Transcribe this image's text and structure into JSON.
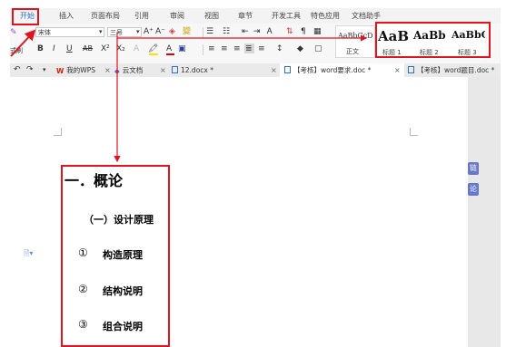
{
  "menu": {
    "items": [
      "开始",
      "插入",
      "页面布局",
      "引用",
      "审阅",
      "视图",
      "章节",
      "开发工具",
      "特色应用",
      "文档助手"
    ]
  },
  "ribbon": {
    "font_name": "宋体",
    "font_size": "三号",
    "format_painter_label": "式刷",
    "format_buttons": [
      "B",
      "I",
      "U",
      "AB",
      "X²",
      "X₂",
      "A",
      "A"
    ],
    "grow_font": "A⁺",
    "shrink_font": "A⁻",
    "normal_style_preview": "AaBbCcD",
    "normal_style_label": "正文",
    "heading_styles": [
      {
        "preview": "AaB",
        "label": "标题 1"
      },
      {
        "preview": "AaBb",
        "label": "标题 2"
      },
      {
        "preview": "AaBbC",
        "label": "标题 3"
      }
    ]
  },
  "tabs": {
    "wps": "我的WPS",
    "cloud": "云文档",
    "items": [
      "12.docx *",
      "【考核】word要求.doc *",
      "【考核】word题目.doc *"
    ]
  },
  "document": {
    "heading1": "一．概论",
    "heading2": "（一）设计原理",
    "items": [
      {
        "marker": "①",
        "text": "构造原理"
      },
      {
        "marker": "②",
        "text": "结构说明"
      },
      {
        "marker": "③",
        "text": "组合说明"
      }
    ]
  },
  "side_buttons": [
    "链",
    "论"
  ],
  "colors": {
    "annotation_red": "#e0141f",
    "accent_blue": "#2b6fc7",
    "wps_red": "#d81e06"
  }
}
